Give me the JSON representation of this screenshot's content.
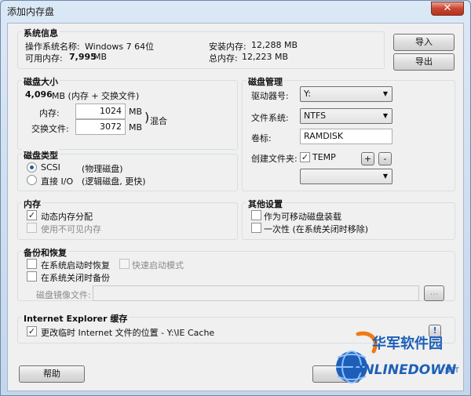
{
  "window": {
    "title": "添加内存盘",
    "close_glyph": "✕"
  },
  "system": {
    "title": "系统信息",
    "os_label": "操作系统名称:",
    "os_value": "Windows 7 64位",
    "avail_label": "可用内存:",
    "avail_value": "7,995",
    "avail_unit": "MB",
    "installed_label": "安装内存:",
    "installed_value": "12,288 MB",
    "total_label": "总内存:",
    "total_value": "12,223 MB"
  },
  "side_buttons": {
    "import": "导入",
    "export": "导出"
  },
  "size": {
    "title": "磁盘大小",
    "total_value": "4,096",
    "total_desc": "MB (内存 + 交换文件)",
    "mem_label": "内存:",
    "mem_value": "1024",
    "mem_unit": "MB",
    "swap_label": "交换文件:",
    "swap_value": "3072",
    "swap_unit": "MB",
    "mix_label": "混合"
  },
  "disk_type": {
    "title": "磁盘类型",
    "scsi_label": "SCSI",
    "scsi_desc": "(物理磁盘)",
    "scsi_selected": true,
    "direct_label": "直接 I/O",
    "direct_desc": "(逻辑磁盘, 更快)"
  },
  "manage": {
    "title": "磁盘管理",
    "drive_label": "驱动器号:",
    "drive_value": "Y:",
    "fs_label": "文件系统:",
    "fs_value": "NTFS",
    "vol_label": "卷标:",
    "vol_value": "RAMDISK",
    "folder_label": "创建文件夹:",
    "folder_name": "TEMP",
    "folder_checked": true,
    "plus": "+",
    "minus": "-"
  },
  "memory": {
    "title": "内存",
    "dynamic_label": "动态内存分配",
    "dynamic_checked": true,
    "invisible_label": "使用不可见内存",
    "invisible_checked": false
  },
  "other": {
    "title": "其他设置",
    "removable_label": "作为可移动磁盘装载",
    "removable_checked": false,
    "onetime_label": "一次性 (在系统关闭时移除)",
    "onetime_checked": false
  },
  "backup": {
    "title": "备份和恢复",
    "restore_label": "在系统启动时恢复",
    "fast_label": "快速启动模式",
    "backup_label": "在系统关闭时备份",
    "image_label": "磁盘镜像文件:",
    "image_value": "",
    "browse": "..."
  },
  "ie": {
    "title": "Internet Explorer 缓存",
    "change_label": "更改临时 Internet 文件的位置 - Y:\\IE Cache",
    "change_checked": true,
    "info_glyph": "!"
  },
  "bottom": {
    "help": "帮助"
  },
  "watermark": {
    "cn": "华军软件园",
    "brand": "ONLINEDOWN",
    "suffix": ".NET"
  },
  "check_glyph": "✓",
  "arrow_glyph": "▼"
}
